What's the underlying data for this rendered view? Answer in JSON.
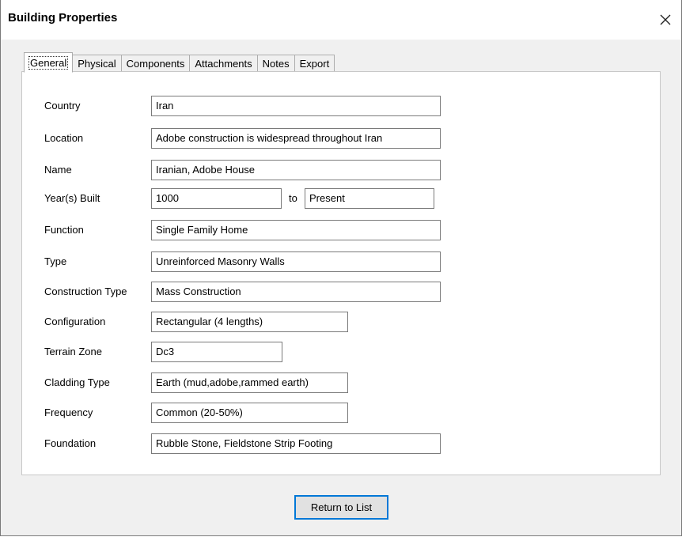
{
  "window": {
    "title": "Building Properties"
  },
  "tabs": [
    {
      "label": "General",
      "active": true
    },
    {
      "label": "Physical",
      "active": false
    },
    {
      "label": "Components",
      "active": false
    },
    {
      "label": "Attachments",
      "active": false
    },
    {
      "label": "Notes",
      "active": false
    },
    {
      "label": "Export",
      "active": false
    }
  ],
  "general": {
    "country": {
      "label": "Country",
      "value": "Iran"
    },
    "location": {
      "label": "Location",
      "value": "Adobe construction is widespread throughout Iran"
    },
    "name": {
      "label": "Name",
      "value": "Iranian, Adobe House"
    },
    "years_built": {
      "label": "Year(s) Built",
      "from": "1000",
      "to_label": "to",
      "to": "Present"
    },
    "function": {
      "label": "Function",
      "value": "Single Family Home"
    },
    "type": {
      "label": "Type",
      "value": "Unreinforced Masonry Walls"
    },
    "construction_type": {
      "label": "Construction Type",
      "value": "Mass Construction"
    },
    "configuration": {
      "label": "Configuration",
      "value": "Rectangular (4 lengths)"
    },
    "terrain_zone": {
      "label": "Terrain Zone",
      "value": "Dc3"
    },
    "cladding_type": {
      "label": "Cladding Type",
      "value": "Earth (mud,adobe,rammed earth)"
    },
    "frequency": {
      "label": "Frequency",
      "value": "Common (20-50%)"
    },
    "foundation": {
      "label": "Foundation",
      "value": "Rubble Stone, Fieldstone Strip Footing"
    }
  },
  "buttons": {
    "return_label": "Return to List"
  },
  "icons": {
    "close": "close-icon"
  },
  "colors": {
    "focus_border": "#0078d7",
    "dialog_bg": "#f0f0f0",
    "field_border": "#7a7a7a"
  }
}
